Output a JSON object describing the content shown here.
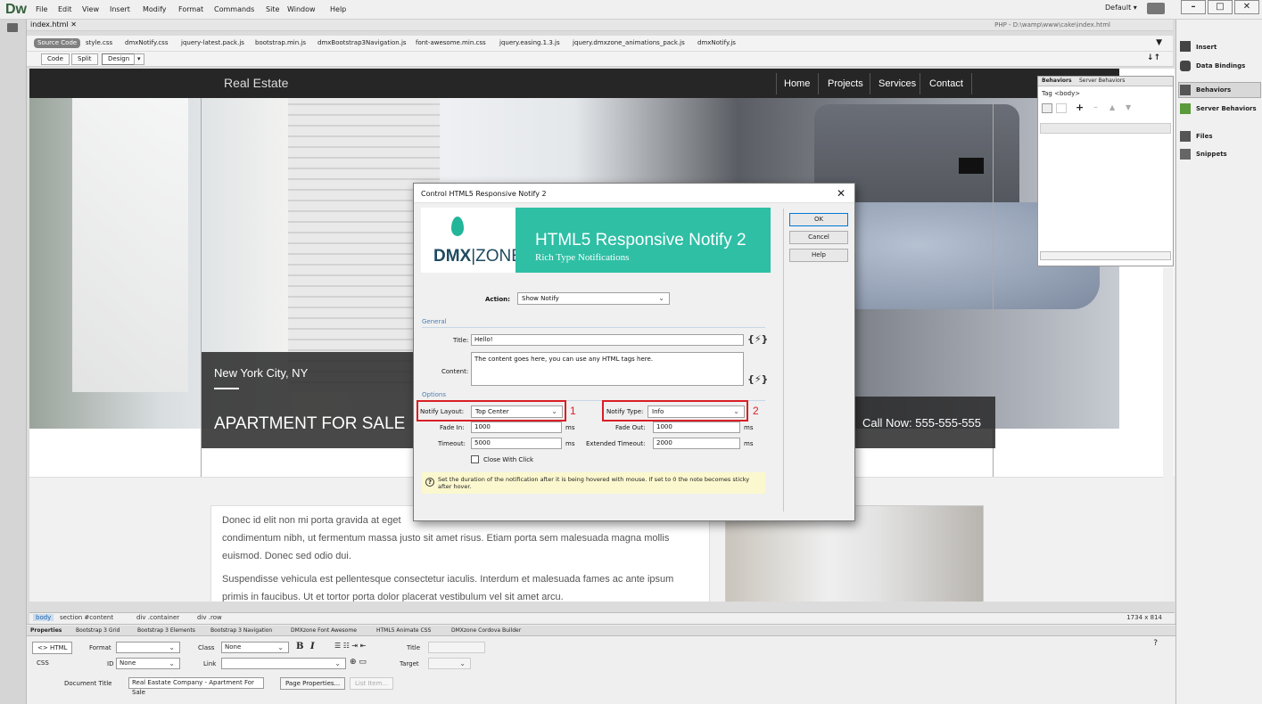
{
  "app": {
    "logo": "Dw",
    "menu": [
      "File",
      "Edit",
      "View",
      "Insert",
      "Modify",
      "Format",
      "Commands",
      "Site",
      "Window",
      "Help"
    ],
    "workspace": "Default",
    "window_buttons": [
      "–",
      "□",
      "✕"
    ]
  },
  "document": {
    "tab": "index.html",
    "path": "PHP - D:\\wamp\\www\\cake\\index.html",
    "source_code": "Source Code",
    "related_files": [
      "style.css",
      "dmxNotify.css",
      "jquery-latest.pack.js",
      "bootstrap.min.js",
      "dmxBootstrap3Navigation.js",
      "font-awesome.min.css",
      "jquery.easing.1.3.js",
      "jquery.dmxzone_animations_pack.js",
      "dmxNotify.js"
    ],
    "view_buttons": [
      "Code",
      "Split",
      "Design"
    ]
  },
  "right_panel": {
    "items": [
      "Insert",
      "Data Bindings",
      "Behaviors",
      "Server Behaviors",
      "Files",
      "Snippets"
    ]
  },
  "behaviors_panel": {
    "tabs": [
      "Behaviors",
      "Server Behaviors"
    ],
    "tag": "Tag <body>"
  },
  "site": {
    "brand": "Real Estate",
    "nav": [
      "Home",
      "Projects",
      "Services",
      "Contact"
    ],
    "city": "New York City, NY",
    "sale": "APARTMENT FOR SALE",
    "call": "Call Now: 555-555-555",
    "paragraphs": [
      "Donec id elit non mi porta gravida at eget",
      "condimentum nibh, ut fermentum massa justo sit amet risus. Etiam porta sem malesuada magna mollis",
      "euismod. Donec sed odio dui.",
      "Suspendisse vehicula est pellentesque consectetur iaculis. Interdum et malesuada fames ac ante ipsum",
      "primis in faucibus. Ut et tortor porta dolor placerat vestibulum vel sit amet arcu."
    ]
  },
  "tagbar": {
    "crumbs": [
      "body",
      "section #content",
      "div .container",
      "div .row"
    ],
    "size": "1734 x 814"
  },
  "properties": {
    "tabs": [
      "Properties",
      "Bootstrap 3 Grid",
      "Bootstrap 3 Elements",
      "Bootstrap 3 Navigation",
      "DMXzone Font Awesome",
      "HTML5 Animate CSS",
      "DMXzone Cordova Builder"
    ],
    "html_btn": "<> HTML",
    "css_btn": "CSS",
    "format_label": "Format",
    "class_label": "Class",
    "class_value": "None",
    "id_label": "ID",
    "id_value": "None",
    "link_label": "Link",
    "title_label": "Title",
    "target_label": "Target",
    "doc_title_label": "Document Title",
    "doc_title_value": "Real Eastate Company - Apartment For Sale",
    "page_props": "Page Properties...",
    "list_item": "List Item..."
  },
  "dialog": {
    "title": "Control HTML5 Responsive Notify 2",
    "close": "✕",
    "logo_main": "DMX",
    "logo_sub": "|ZONE",
    "banner_title": "HTML5 Responsive Notify 2",
    "banner_sub": "Rich Type Notifications",
    "buttons": {
      "ok": "OK",
      "cancel": "Cancel",
      "help": "Help"
    },
    "action_label": "Action:",
    "action_value": "Show Notify",
    "general": "General",
    "title_label": "Title:",
    "title_value": "Hello!",
    "content_label": "Content:",
    "content_value": "The content goes here, you can use any HTML tags here.",
    "options": "Options",
    "layout_label": "Notify Layout:",
    "layout_value": "Top Center",
    "type_label": "Notify Type:",
    "type_value": "Info",
    "marker1": "1",
    "marker2": "2",
    "fadein_label": "Fade In:",
    "fadein_value": "1000",
    "fadeout_label": "Fade Out:",
    "fadeout_value": "1000",
    "timeout_label": "Timeout:",
    "timeout_value": "5000",
    "ext_timeout_label": "Extended Timeout:",
    "ext_timeout_value": "2000",
    "ms": "ms",
    "close_click": "Close With Click",
    "hint": "Set the duration of the notification after it is being hovered with mouse. If set to 0 the note becomes sticky after hover."
  },
  "colors": {
    "accent": "#2ebfa5",
    "highlight": "#d91f26",
    "nav_bg": "#262626"
  }
}
